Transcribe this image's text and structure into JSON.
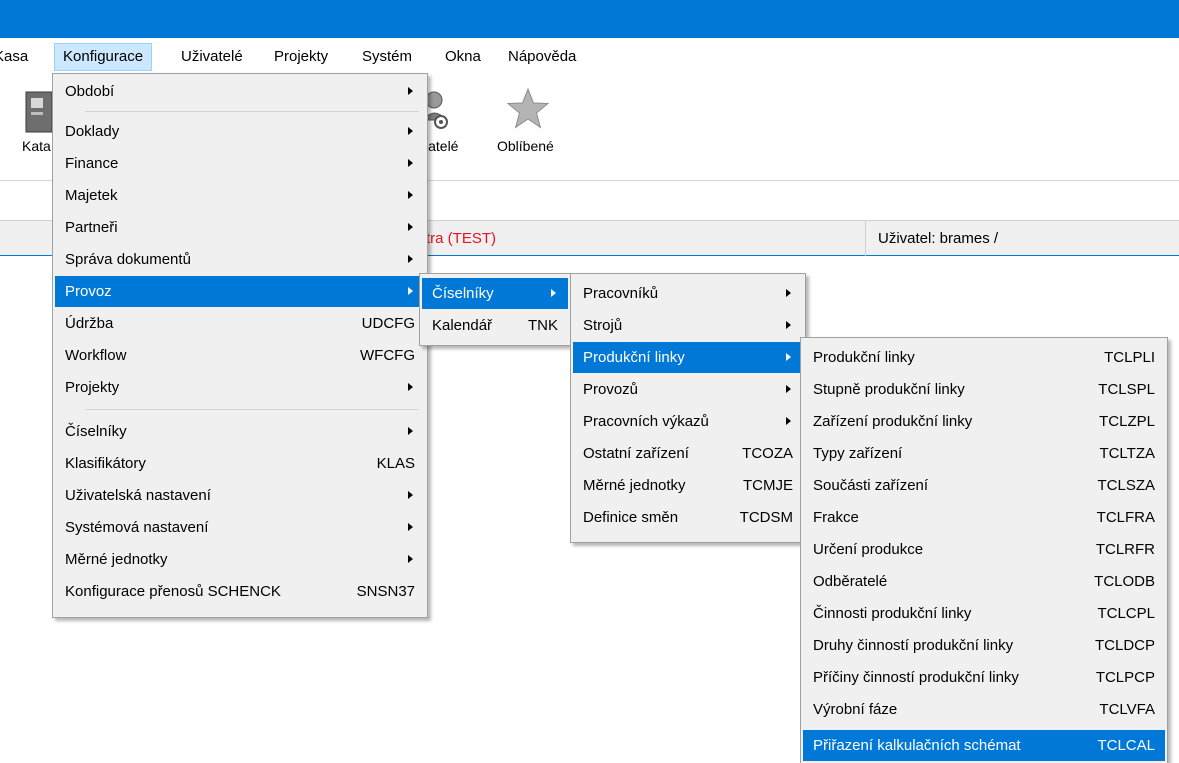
{
  "menubar": [
    "Kasa",
    "Konfigurace",
    "Uživatelé",
    "Projekty",
    "Systém",
    "Okna",
    "Nápověda"
  ],
  "toolbar": {
    "katalog": "Kata",
    "uzivatele": "ivatelé",
    "oblibene": "Oblíbené"
  },
  "status": {
    "context": "tra (TEST)",
    "user": "Uživatel: brames /"
  },
  "icons": [
    "catalog-icon",
    "users-gear-icon",
    "star-icon"
  ],
  "colors": {
    "titlebar": "#0078d7",
    "selection": "#0078d7",
    "status_alert": "#e81123"
  },
  "menu_konfigurace": [
    {
      "label": "Období",
      "sub": true
    },
    {
      "label": "Doklady",
      "sub": true
    },
    {
      "label": "Finance",
      "sub": true
    },
    {
      "label": "Majetek",
      "sub": true
    },
    {
      "label": "Partneři",
      "sub": true
    },
    {
      "label": "Správa dokumentů",
      "sub": true
    },
    {
      "label": "Provoz",
      "sub": true
    },
    {
      "label": "Údržba",
      "shortcut": "UDCFG"
    },
    {
      "label": "Workflow",
      "shortcut": "WFCFG"
    },
    {
      "label": "Projekty",
      "sub": true
    },
    {
      "label": "Číselníky",
      "sub": true
    },
    {
      "label": "Klasifikátory",
      "shortcut": "KLAS"
    },
    {
      "label": "Uživatelská nastavení",
      "sub": true
    },
    {
      "label": "Systémová nastavení",
      "sub": true
    },
    {
      "label": "Měrné jednotky",
      "sub": true
    },
    {
      "label": "Konfigurace přenosů SCHENCK",
      "shortcut": "SNSN37"
    }
  ],
  "menu_provoz": [
    {
      "label": "Číselníky",
      "sub": true
    },
    {
      "label": "Kalendář",
      "shortcut": "TNK"
    }
  ],
  "menu_ciselniky": [
    {
      "label": "Pracovníků",
      "sub": true
    },
    {
      "label": "Strojů",
      "sub": true
    },
    {
      "label": "Produkční linky",
      "sub": true
    },
    {
      "label": "Provozů",
      "sub": true
    },
    {
      "label": "Pracovních výkazů",
      "sub": true
    },
    {
      "label": "Ostatní zařízení",
      "shortcut": "TCOZA"
    },
    {
      "label": "Měrné jednotky",
      "shortcut": "TCMJE"
    },
    {
      "label": "Definice směn",
      "shortcut": "TCDSM"
    }
  ],
  "menu_produkcni_linky": [
    {
      "label": "Produkční linky",
      "shortcut": "TCLPLI"
    },
    {
      "label": "Stupně produkční linky",
      "shortcut": "TCLSPL"
    },
    {
      "label": "Zařízení produkční linky",
      "shortcut": "TCLZPL"
    },
    {
      "label": "Typy zařízení",
      "shortcut": "TCLTZA"
    },
    {
      "label": "Součásti zařízení",
      "shortcut": "TCLSZA"
    },
    {
      "label": "Frakce",
      "shortcut": "TCLFRA"
    },
    {
      "label": "Určení produkce",
      "shortcut": "TCLRFR"
    },
    {
      "label": "Odběratelé",
      "shortcut": "TCLODB"
    },
    {
      "label": "Činnosti produkční linky",
      "shortcut": "TCLCPL"
    },
    {
      "label": "Druhy činností produkční linky",
      "shortcut": "TCLDCP"
    },
    {
      "label": "Příčiny činností produkční linky",
      "shortcut": "TCLPCP"
    },
    {
      "label": "Výrobní fáze",
      "shortcut": "TCLVFA"
    },
    {
      "label": "Přiřazení kalkulačních schémat",
      "shortcut": "TCLCAL"
    }
  ]
}
